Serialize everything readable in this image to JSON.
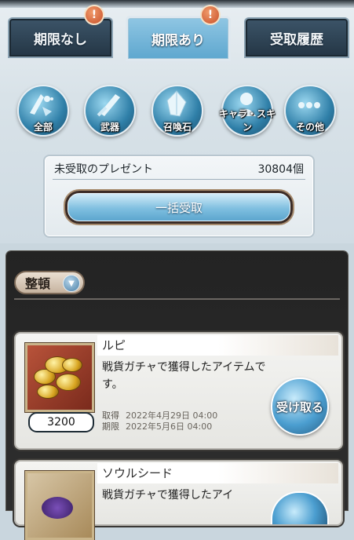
{
  "tabs": [
    {
      "label": "期限なし",
      "badge": "!"
    },
    {
      "label": "期限あり",
      "badge": "!"
    },
    {
      "label": "受取履歴"
    }
  ],
  "categories": [
    {
      "label": "全部",
      "icon": "all-items-icon"
    },
    {
      "label": "武器",
      "icon": "weapon-icon"
    },
    {
      "label": "召喚石",
      "icon": "summon-stone-icon"
    },
    {
      "label": "キャラ・スキン",
      "icon": "character-skin-icon"
    },
    {
      "label": "その他",
      "icon": "other-icon"
    }
  ],
  "summary": {
    "label": "未受取のプレゼント",
    "count": "30804個",
    "bulk_button": "一括受取"
  },
  "sort": {
    "label": "整頓"
  },
  "items": [
    {
      "name": "ルピ",
      "description": "戦貨ガチャで獲得したアイテムです。",
      "quantity": "3200",
      "acquired_label": "取得",
      "acquired": "2022年4月29日 04:00",
      "expiry_label": "期限",
      "expiry": "2022年5月6日 04:00",
      "receive_button": "受け取る"
    },
    {
      "name": "ソウルシード",
      "description": "戦貨ガチャで獲得したアイ"
    }
  ]
}
